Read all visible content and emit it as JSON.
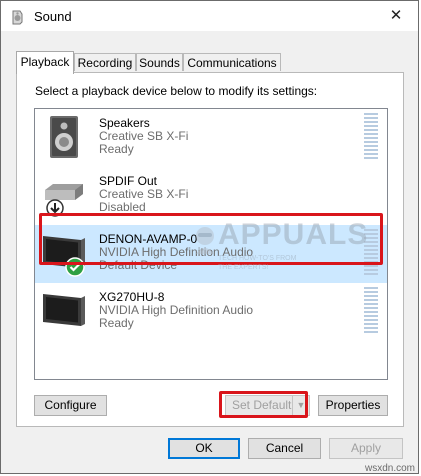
{
  "window": {
    "title": "Sound",
    "close_glyph": "✕"
  },
  "tabs": [
    {
      "label": "Playback",
      "active": true
    },
    {
      "label": "Recording",
      "active": false
    },
    {
      "label": "Sounds",
      "active": false
    },
    {
      "label": "Communications",
      "active": false
    }
  ],
  "instruction": "Select a playback device below to modify its settings:",
  "devices": [
    {
      "name": "Speakers",
      "description": "Creative SB X-Fi",
      "status": "Ready",
      "icon": "speaker-icon",
      "selected": false
    },
    {
      "name": "SPDIF Out",
      "description": "Creative SB X-Fi",
      "status": "Disabled",
      "icon": "spdif-device-icon",
      "selected": false
    },
    {
      "name": "DENON-AVAMP-0",
      "description": "NVIDIA High Definition Audio",
      "status": "Default Device",
      "icon": "monitor-icon",
      "selected": true
    },
    {
      "name": "XG270HU-8",
      "description": "NVIDIA High Definition Audio",
      "status": "Ready",
      "icon": "monitor-icon",
      "selected": false
    }
  ],
  "buttons": {
    "configure": "Configure",
    "set_default": "Set Default",
    "properties": "Properties",
    "ok": "OK",
    "cancel": "Cancel",
    "apply": "Apply"
  },
  "watermark": {
    "brand": "APPUALS",
    "tagline_1": "TECH HOW-TO'S FROM",
    "tagline_2": "THE EXPERTS!"
  },
  "site_mark": "wsxdn.com",
  "colors": {
    "selection": "#cce8ff",
    "highlight_box": "#d9151b",
    "default_check": "#2ea043"
  }
}
